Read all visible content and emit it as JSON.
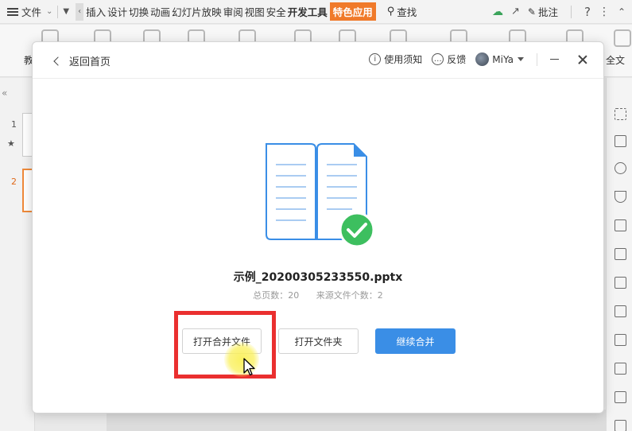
{
  "menubar": {
    "file_label": "文件",
    "tabs": [
      "插入",
      "设计",
      "切换",
      "动画",
      "幻灯片放映",
      "审阅",
      "视图",
      "安全",
      "开发工具",
      "特色应用"
    ],
    "search_label": "查找",
    "comment_label": "批注",
    "help_label": "?"
  },
  "ribbon": {
    "left_label": "教",
    "right_label": "全文"
  },
  "slides": {
    "numbers": [
      "1",
      "2"
    ]
  },
  "dialog": {
    "back_label": "返回首页",
    "usage_label": "使用须知",
    "feedback_label": "反馈",
    "user_name": "MiYa",
    "filename": "示例_20200305233550.pptx",
    "page_count_text": "总页数：20",
    "source_count_text": "来源文件个数：2",
    "buttons": {
      "open_merged": "打开合并文件",
      "open_folder": "打开文件夹",
      "continue_merge": "继续合并"
    }
  },
  "colors": {
    "accent_blue": "#3a8ee6",
    "success_green": "#3dbf5f",
    "highlight_red": "#ea2f2f",
    "special_tab": "#f07a2a"
  }
}
